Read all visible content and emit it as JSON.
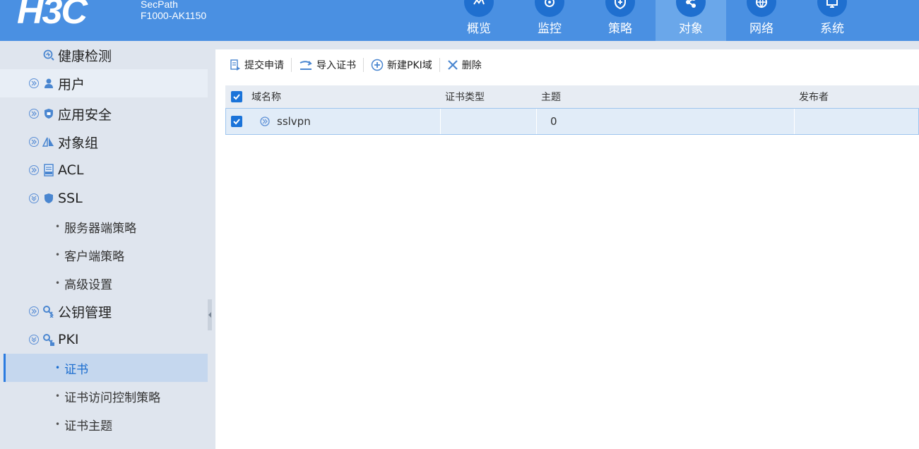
{
  "header": {
    "logo": "H3C",
    "product_line1": "SecPath",
    "product_line2": "F1000-AK1150",
    "nav": [
      {
        "label": "概览",
        "icon": "overview-icon"
      },
      {
        "label": "监控",
        "icon": "monitor-icon"
      },
      {
        "label": "策略",
        "icon": "policy-shield-icon"
      },
      {
        "label": "对象",
        "icon": "object-share-icon",
        "active": true
      },
      {
        "label": "网络",
        "icon": "network-globe-icon"
      },
      {
        "label": "系统",
        "icon": "system-monitor-icon"
      }
    ]
  },
  "sidebar": {
    "health": "健康检测",
    "items": [
      {
        "label": "用户",
        "icon": "user-icon"
      },
      {
        "label": "应用安全",
        "icon": "app-security-shield-icon"
      },
      {
        "label": "对象组",
        "icon": "object-group-icon"
      },
      {
        "label": "ACL",
        "icon": "acl-document-icon"
      },
      {
        "label": "SSL",
        "icon": "ssl-shield-icon"
      },
      {
        "label": "公钥管理",
        "icon": "public-key-icon"
      },
      {
        "label": "PKI",
        "icon": "pki-key-icon"
      }
    ],
    "ssl_children": [
      "服务器端策略",
      "客户端策略",
      "高级设置"
    ],
    "pki_children": [
      "证书",
      "证书访问控制策略",
      "证书主题"
    ],
    "active_child": "证书"
  },
  "toolbar": {
    "submit": "提交申请",
    "import": "导入证书",
    "new_domain": "新建PKI域",
    "delete": "删除"
  },
  "grid": {
    "headers": [
      "域名称",
      "证书类型",
      "主题",
      "发布者"
    ],
    "rows": [
      {
        "domain": "sslvpn",
        "cert_type": "",
        "subject": "0",
        "issuer": "",
        "checked": true
      }
    ]
  },
  "colors": {
    "header_bg": "#4a90e2",
    "active_nav": "#6aa7ea",
    "accent": "#1a73d9"
  }
}
